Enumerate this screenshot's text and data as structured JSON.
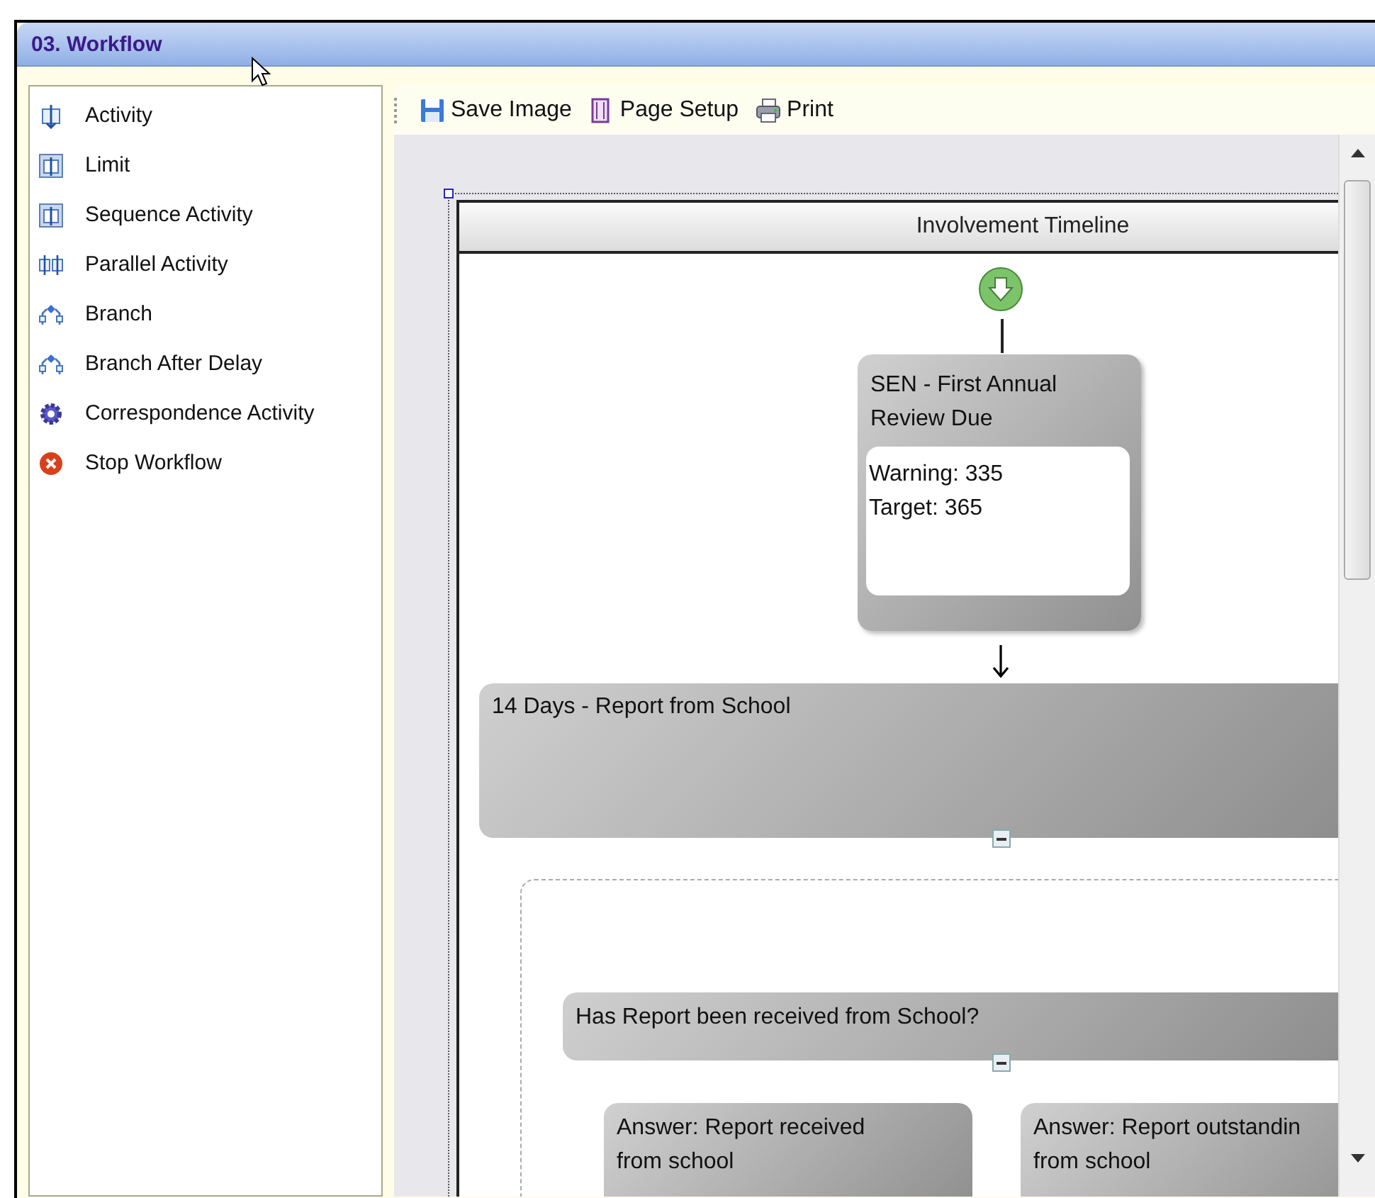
{
  "window": {
    "title": "03. Workflow"
  },
  "palette": {
    "items": [
      {
        "label": "Activity",
        "kind": "activity"
      },
      {
        "label": "Limit",
        "kind": "limit"
      },
      {
        "label": "Sequence Activity",
        "kind": "sequence"
      },
      {
        "label": "Parallel Activity",
        "kind": "parallel"
      },
      {
        "label": "Branch",
        "kind": "branch"
      },
      {
        "label": "Branch After Delay",
        "kind": "branch"
      },
      {
        "label": "Correspondence Activity",
        "kind": "gear"
      },
      {
        "label": "Stop Workflow",
        "kind": "stop"
      }
    ]
  },
  "toolbar": {
    "buttons": [
      {
        "label": "Save Image",
        "kind": "save"
      },
      {
        "label": "Page Setup",
        "kind": "page"
      },
      {
        "label": "Print",
        "kind": "print"
      }
    ]
  },
  "diagram": {
    "title": "Involvement Timeline",
    "step": {
      "title_lines": [
        "SEN - First Annual",
        "Review Due"
      ],
      "details": [
        "Warning: 335",
        "Target: 365"
      ]
    },
    "delay": {
      "title": "14 Days - Report from School",
      "expanded": true
    },
    "question": {
      "title": "Has Report been received from School?",
      "expanded": true
    },
    "answers": [
      {
        "lines": [
          "Answer: Report received",
          "from school"
        ]
      },
      {
        "lines": [
          "Answer: Report outstandin",
          "from school"
        ]
      }
    ]
  }
}
